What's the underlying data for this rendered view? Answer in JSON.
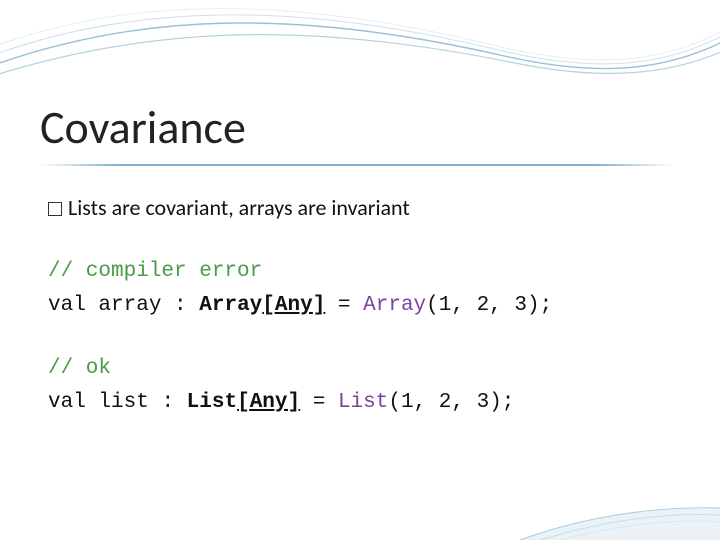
{
  "slide": {
    "title": "Covariance",
    "bullet": "Lists are covariant, arrays are invariant",
    "block1": {
      "comment": "// compiler error",
      "kw_val": "val",
      "ident": "array",
      "colon": ":",
      "type_name": "Array",
      "type_open": "[",
      "type_param": "Any",
      "type_close": "]",
      "eq": "=",
      "call": "Array",
      "args": "(1, 2, 3);"
    },
    "block2": {
      "comment": "// ok",
      "kw_val": "val",
      "ident": "list",
      "colon": ":",
      "type_name": "List",
      "type_open": "[",
      "type_param": "Any",
      "type_close": "]",
      "eq": "=",
      "call": "List",
      "args": "(1, 2, 3);"
    }
  }
}
